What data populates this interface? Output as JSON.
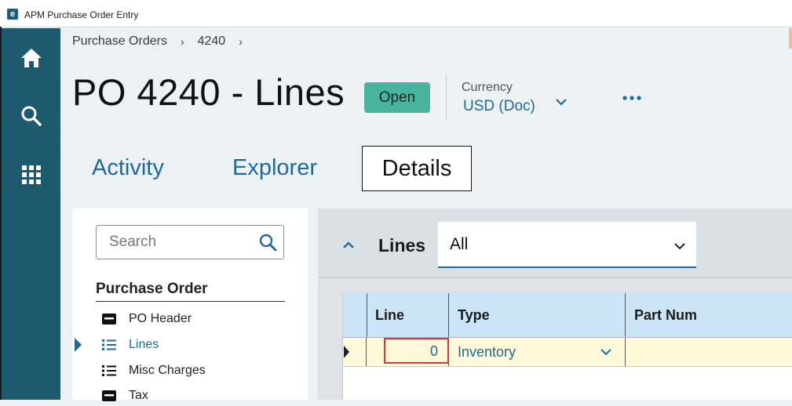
{
  "window": {
    "title": "APM Purchase Order Entry",
    "logo_glyph": "e"
  },
  "rail": {
    "items": [
      "home-icon",
      "search-icon",
      "apps-grid-icon"
    ]
  },
  "breadcrumb": {
    "items": [
      "Purchase Orders",
      "4240"
    ],
    "separator": "›"
  },
  "header": {
    "title": "PO 4240 - Lines",
    "status": "Open",
    "currency_label": "Currency",
    "currency_value": "USD (Doc)",
    "more_glyph": "•••"
  },
  "tabs": [
    {
      "label": "Activity",
      "selected": false
    },
    {
      "label": "Explorer",
      "selected": false
    },
    {
      "label": "Details",
      "selected": true
    }
  ],
  "sidebar": {
    "search_placeholder": "Search",
    "section_title": "Purchase Order",
    "items": [
      {
        "label": "PO Header",
        "icon": "form-icon",
        "active": false
      },
      {
        "label": "Lines",
        "icon": "list-icon",
        "active": true
      },
      {
        "label": "Misc Charges",
        "icon": "list-icon",
        "active": false
      },
      {
        "label": "Tax",
        "icon": "form-icon",
        "active": false
      }
    ]
  },
  "lines_panel": {
    "title": "Lines",
    "filter_value": "All",
    "grid": {
      "columns": [
        "Line",
        "Type",
        "Part Num"
      ],
      "rows": [
        {
          "line": "0",
          "type": "Inventory",
          "part_num": ""
        }
      ]
    }
  },
  "colors": {
    "rail": "#1d5a6e",
    "accent": "#1d6b9b",
    "status_open": "#48b49f",
    "grid_header": "#cce5f6",
    "selected_row": "#fff8d9",
    "error_border": "#d9363e"
  }
}
